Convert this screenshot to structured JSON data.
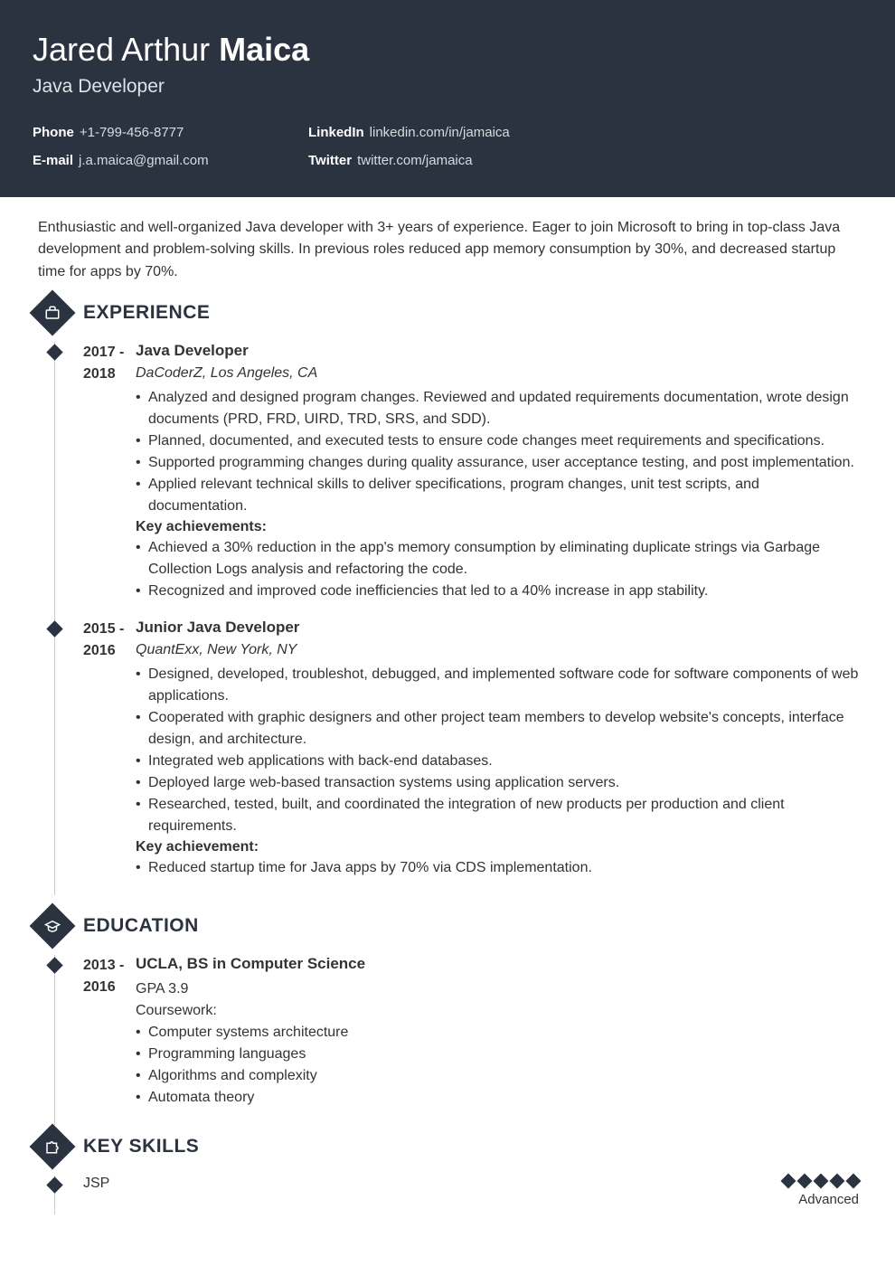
{
  "header": {
    "first_name": "Jared Arthur",
    "last_name": "Maica",
    "title": "Java Developer",
    "contacts_left": [
      {
        "label": "Phone",
        "value": "+1-799-456-8777"
      },
      {
        "label": "E-mail",
        "value": "j.a.maica@gmail.com"
      }
    ],
    "contacts_right": [
      {
        "label": "LinkedIn",
        "value": "linkedin.com/in/jamaica"
      },
      {
        "label": "Twitter",
        "value": "twitter.com/jamaica"
      }
    ]
  },
  "summary": "Enthusiastic and well-organized Java developer with 3+ years of experience. Eager to join Microsoft to bring in top-class Java development and problem-solving skills. In previous roles reduced app memory consumption by 30%, and decreased startup time for apps by 70%.",
  "sections": {
    "experience": {
      "heading": "EXPERIENCE",
      "entries": [
        {
          "date": "2017 - 2018",
          "title": "Java Developer",
          "subtitle": "DaCoderZ, Los Angeles, CA",
          "bullets": [
            "Analyzed and designed program changes. Reviewed and updated requirements documentation, wrote design documents (PRD, FRD, UIRD, TRD, SRS, and SDD).",
            "Planned, documented, and executed tests to ensure code changes meet requirements and specifications.",
            "Supported programming changes during quality assurance, user acceptance testing, and post implementation.",
            "Applied relevant technical skills to deliver specifications, program changes, unit test scripts, and documentation."
          ],
          "key_label": "Key achievements:",
          "key_bullets": [
            "Achieved a 30% reduction in the app's memory consumption by eliminating duplicate strings via Garbage Collection Logs analysis and refactoring the code.",
            "Recognized and improved code inefficiencies that led to a 40% increase in app stability."
          ]
        },
        {
          "date": "2015 - 2016",
          "title": "Junior Java Developer",
          "subtitle": "QuantExx, New York, NY",
          "bullets": [
            "Designed, developed, troubleshot, debugged, and implemented software code for software components of web applications.",
            "Cooperated with graphic designers and other project team members to develop website's concepts, interface design, and architecture.",
            "Integrated web applications with back-end databases.",
            "Deployed large web-based transaction systems using application servers.",
            "Researched, tested, built, and coordinated the integration of new products per production and client requirements."
          ],
          "key_label": "Key achievement:",
          "key_bullets": [
            "Reduced startup time for Java apps by 70% via CDS implementation."
          ]
        }
      ]
    },
    "education": {
      "heading": "EDUCATION",
      "entries": [
        {
          "date": "2013 - 2016",
          "title": "UCLA, BS in Computer Science",
          "gpa": "GPA 3.9",
          "coursework_label": "Coursework:",
          "bullets": [
            "Computer systems architecture",
            "Programming languages",
            "Algorithms and complexity",
            "Automata theory"
          ]
        }
      ]
    },
    "skills": {
      "heading": "KEY SKILLS",
      "items": [
        {
          "name": "JSP",
          "level": "Advanced",
          "rating": 5
        }
      ]
    }
  }
}
